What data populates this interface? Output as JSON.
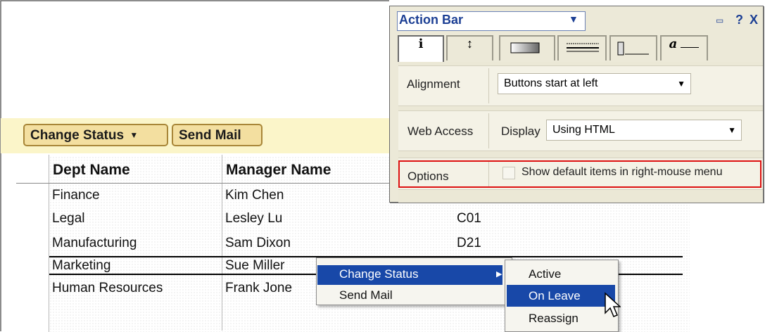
{
  "action_bar": {
    "change_status_label": "Change Status",
    "caret_icon": "▼",
    "send_mail_label": "Send Mail"
  },
  "table": {
    "headers": [
      "Dept Name",
      "Manager Name"
    ],
    "rows": [
      {
        "dept": "Finance",
        "manager": "Kim Chen",
        "code": ""
      },
      {
        "dept": "Legal",
        "manager": "Lesley Lu",
        "code": "C01"
      },
      {
        "dept": "Manufacturing",
        "manager": "Sam Dixon",
        "code": "D21"
      },
      {
        "dept": "Marketing",
        "manager": "Sue Miller",
        "code": ""
      },
      {
        "dept": "Human Resources",
        "manager": "Frank Jone",
        "code": ""
      }
    ]
  },
  "properties_panel": {
    "title": "Action Bar",
    "controls": {
      "minimize": "▭",
      "help": "?",
      "close": "X"
    },
    "tabs": [
      "i",
      "↕",
      "",
      "",
      "",
      "a"
    ],
    "rows": [
      {
        "label": "Alignment",
        "value": "Buttons start at left"
      },
      {
        "label": "Web Access",
        "sub_label": "Display",
        "value": "Using HTML"
      },
      {
        "label": "Options",
        "checkbox_label": "Show default items in right-mouse menu",
        "checked": false
      }
    ]
  },
  "context_menu": {
    "items": [
      "Change Status",
      "Send Mail"
    ],
    "submenu_arrow": "▶",
    "submenu_items": [
      "Active",
      "On Leave",
      "Reassign"
    ],
    "highlighted_submenu_item": "On Leave"
  },
  "colors": {
    "highlight_blue": "#1848a8",
    "callout_red": "#dd1111",
    "action_bar_bg": "#fbf5c9",
    "button_bg": "#f3dfa0",
    "panel_title_color": "#1c3f94"
  }
}
